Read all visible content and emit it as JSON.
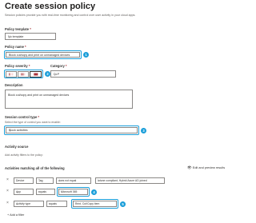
{
  "header": {
    "title": "Create session policy",
    "subtitle": "Session policies provide you with real-time monitoring and control over user activity in your cloud apps."
  },
  "template": {
    "label": "Policy template",
    "required_mark": "*",
    "value": "No template"
  },
  "name": {
    "label": "Policy name",
    "required_mark": "*",
    "value": "Block cut/copy and print on unmanaged devices",
    "step": "1"
  },
  "severity": {
    "label": "Policy severity",
    "required_mark": "*",
    "step": "2",
    "selected": "high"
  },
  "category": {
    "label": "Category",
    "required_mark": "*",
    "value": "DLP"
  },
  "description": {
    "label": "Description",
    "value": "Block cut/copy and print on unmanaged devices"
  },
  "session_control": {
    "label": "Session control type",
    "required_mark": "*",
    "hint": "Select the type of control you want to enable:",
    "value": "Block activities",
    "step": "3"
  },
  "activity_source": {
    "label": "Activity source",
    "hint": "Add activity filters to the policy:"
  },
  "filters": {
    "label": "Activities matching all of the following",
    "edit_preview": "Edit and preview results",
    "rows": [
      {
        "field": "Device",
        "sub": "Tag",
        "op": "does not equal",
        "value": "Intune compliant, Hybrid Azure AD joined"
      },
      {
        "field": "App",
        "op": "equals",
        "value": "Microsoft 365",
        "step": "4"
      },
      {
        "field": "Activity type",
        "op": "equals",
        "value": "Print, Cut/Copy item",
        "step": "5"
      }
    ],
    "add_filter": "Add a filter"
  },
  "colors": {
    "accent": "#1a9ed9",
    "severity_high": "#a4262c",
    "link": "#0078d4"
  }
}
